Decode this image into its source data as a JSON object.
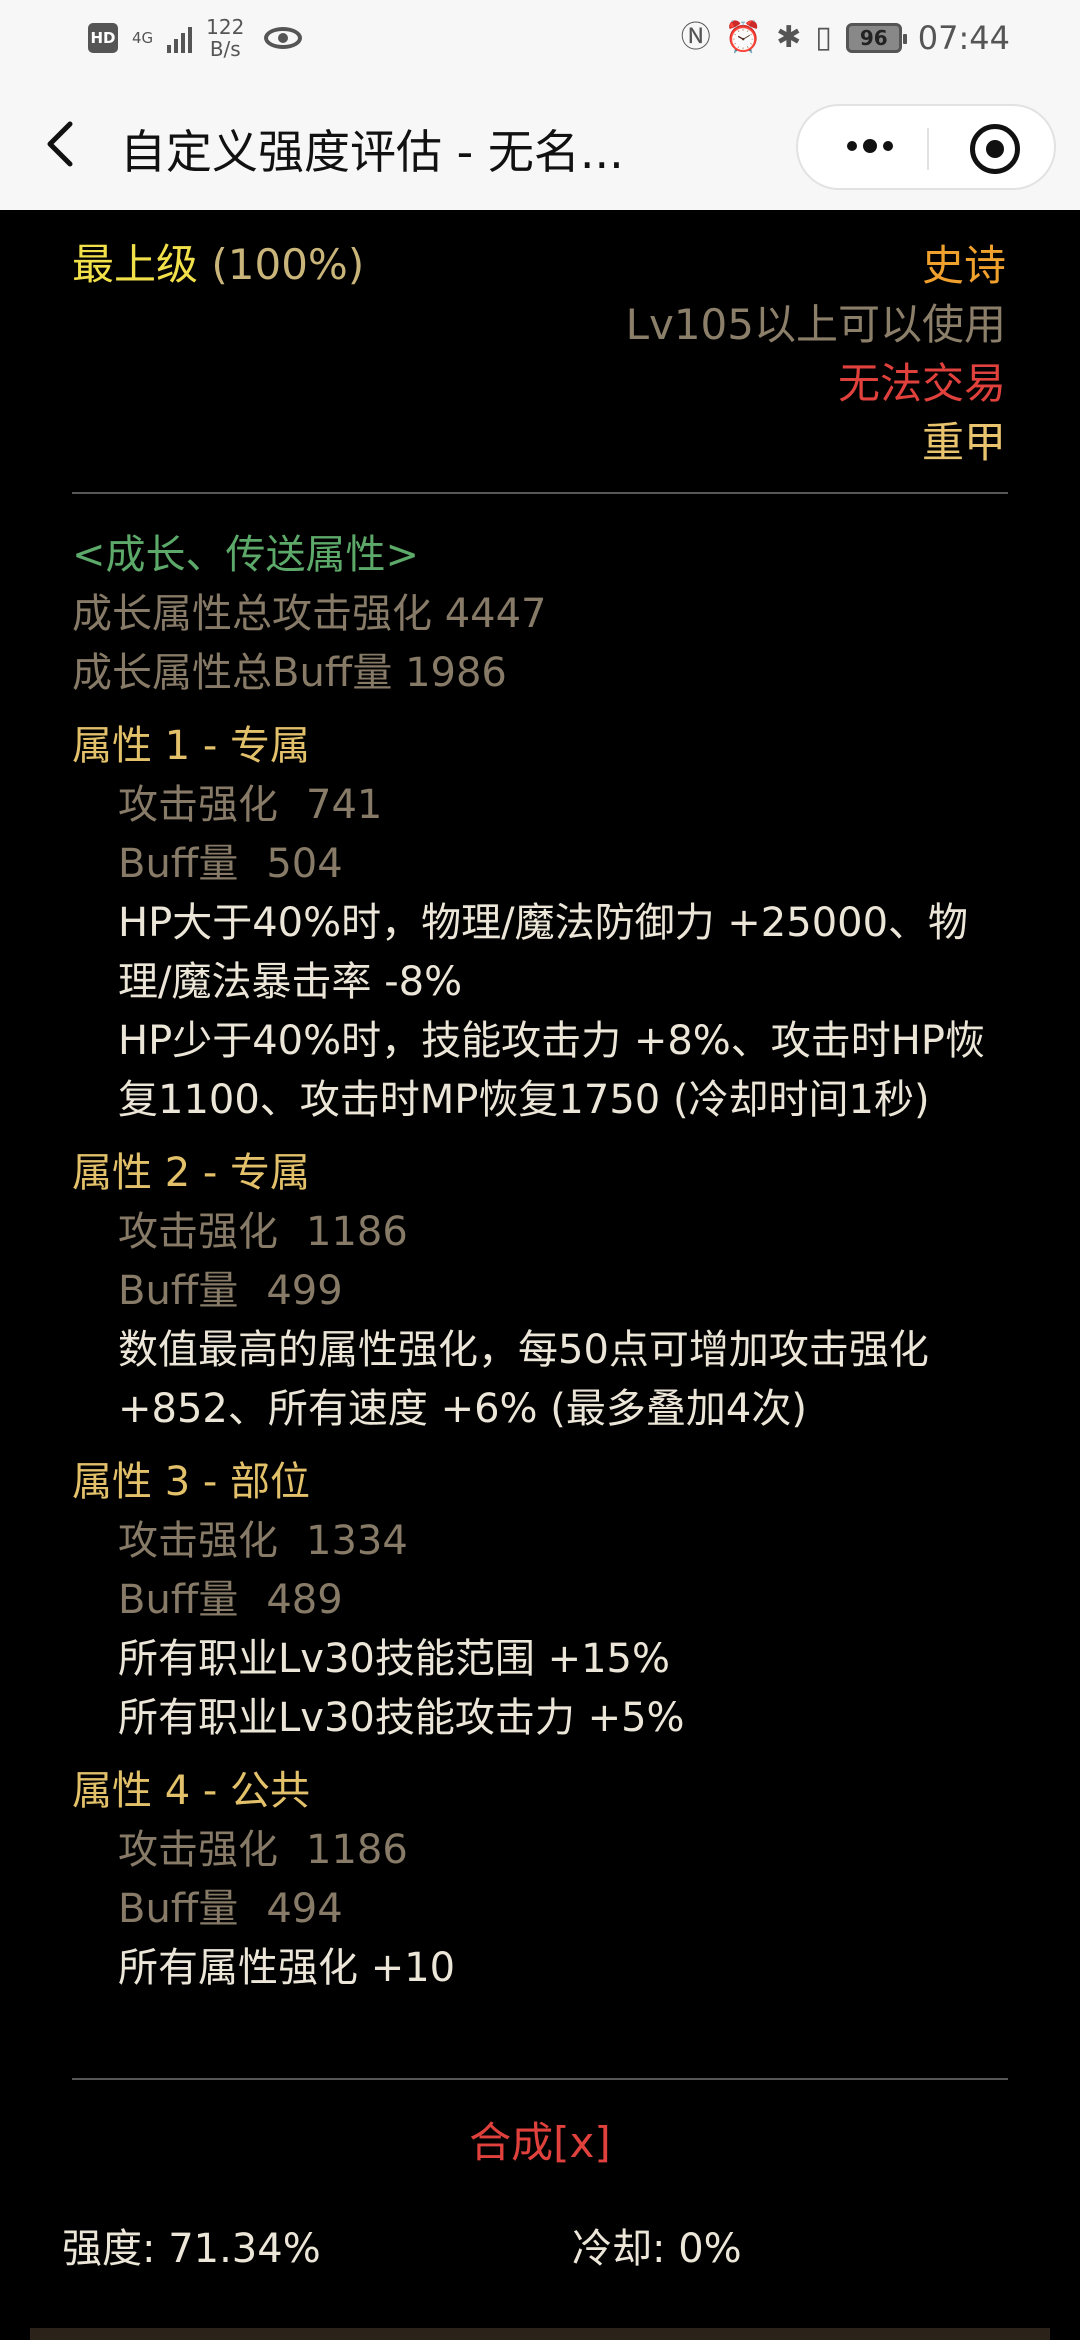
{
  "status_bar": {
    "hd": "HD",
    "network": "4G",
    "speed_value": "122",
    "speed_unit": "B/s",
    "battery": "96",
    "time": "07:44"
  },
  "nav": {
    "title": "自定义强度评估 - 无名..."
  },
  "item": {
    "grade": "最上级",
    "grade_percent": "(100%)",
    "rarity": "史诗",
    "level_req": "Lv105以上可以使用",
    "trade": "无法交易",
    "armor_type": "重甲"
  },
  "growth": {
    "heading": "<成长、传送属性>",
    "total_atk": "成长属性总攻击强化 4447",
    "total_buff": "成长属性总Buff量 1986"
  },
  "attributes": [
    {
      "title": "属性 1 - 专属",
      "atk_label": "攻击强化",
      "atk_value": "741",
      "buff_label": "Buff量",
      "buff_value": "504",
      "effects": [
        "HP大于40%时，物理/魔法防御力 +25000、物理/魔法暴击率 -8%",
        "HP少于40%时，技能攻击力 +8%、攻击时HP恢复1100、攻击时MP恢复1750 (冷却时间1秒)"
      ]
    },
    {
      "title": "属性 2 - 专属",
      "atk_label": "攻击强化",
      "atk_value": "1186",
      "buff_label": "Buff量",
      "buff_value": "499",
      "effects": [
        "数值最高的属性强化，每50点可增加攻击强化 +852、所有速度 +6% (最多叠加4次)"
      ]
    },
    {
      "title": "属性 3 - 部位",
      "atk_label": "攻击强化",
      "atk_value": "1334",
      "buff_label": "Buff量",
      "buff_value": "489",
      "effects": [
        "所有职业Lv30技能范围 +15%",
        "所有职业Lv30技能攻击力 +5%"
      ]
    },
    {
      "title": "属性 4 - 公共",
      "atk_label": "攻击强化",
      "atk_value": "1186",
      "buff_label": "Buff量",
      "buff_value": "494",
      "effects": [
        "所有属性强化 +10"
      ]
    }
  ],
  "combine_label": "合成[x]",
  "footer": {
    "strength": "强度: 71.34%",
    "cooldown": "冷却: 0%"
  }
}
